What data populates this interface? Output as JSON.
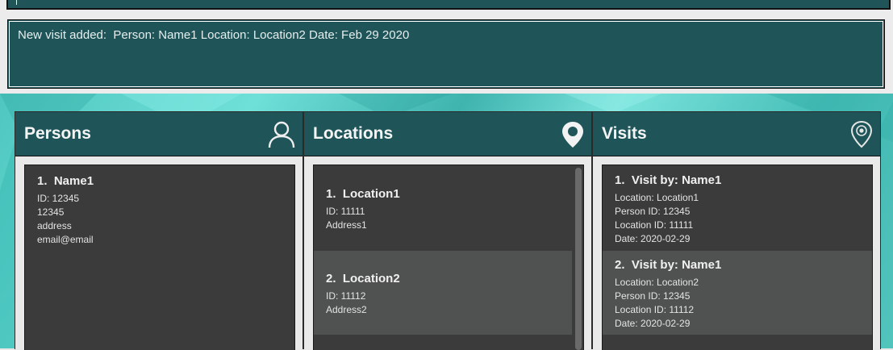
{
  "command_box": {
    "value": ""
  },
  "result_display": {
    "text": "New visit added:  Person: Name1 Location: Location2 Date: Feb 29 2020"
  },
  "panels": {
    "persons": {
      "title": "Persons",
      "icon": "person-icon",
      "items": [
        {
          "title": "1.  Name1",
          "lines": [
            "ID: 12345",
            "12345",
            "address",
            "email@email"
          ]
        }
      ]
    },
    "locations": {
      "title": "Locations",
      "icon": "map-pin-icon",
      "items": [
        {
          "title": "1.  Location1",
          "lines": [
            "ID: 11111",
            "Address1"
          ]
        },
        {
          "title": "2.  Location2",
          "lines": [
            "ID: 11112",
            "Address2"
          ]
        }
      ]
    },
    "visits": {
      "title": "Visits",
      "icon": "location-marker-icon",
      "items": [
        {
          "title": "1.  Visit by: Name1",
          "lines": [
            "Location: Location1",
            "Person ID: 12345",
            "Location ID: 11111",
            "Date: 2020-02-29"
          ]
        },
        {
          "title": "2.  Visit by: Name1",
          "lines": [
            "Location: Location2",
            "Person ID: 12345",
            "Location ID: 11112",
            "Date: 2020-02-29"
          ]
        }
      ]
    }
  },
  "colors": {
    "header_teal": "#1f5558",
    "list_dark": "#3b3b3b",
    "list_selected": "#505252",
    "background_teal": "#4fc7c0"
  }
}
